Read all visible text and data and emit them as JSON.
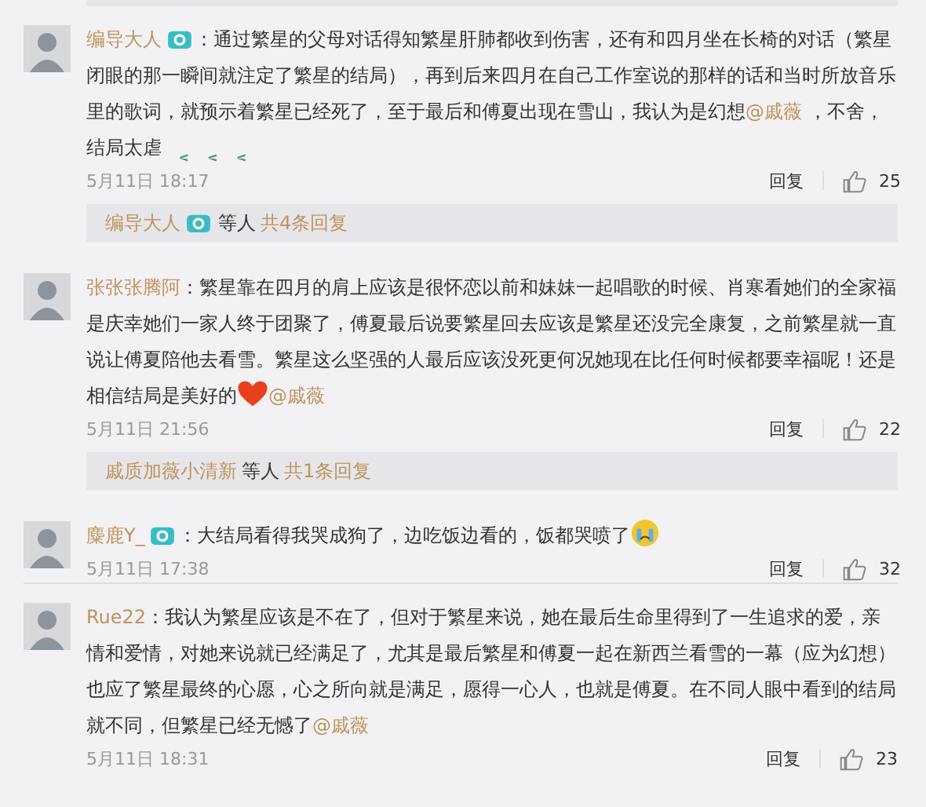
{
  "comments": [
    {
      "user": "编导大人",
      "badge": true,
      "parts": [
        {
          "kind": "text",
          "text": "：通过繁星的父母对话得知繁星肝肺都收到伤害，还有和四月坐在长椅的对话（繁星闭眼的那一瞬间就注定了繁星的结局），再到后来四月在自己工作室说的那样的话和当时所放音乐里的歌词，就预示着繁星已经死了，至于最后和傅夏出现在雪山，我认为是幻想"
        },
        {
          "kind": "mention",
          "text": "@戚薇"
        },
        {
          "kind": "text",
          "text": " ，不舍，结局太虐"
        },
        {
          "kind": "marks"
        }
      ],
      "time": "5月11日 18:17",
      "reply": "回复",
      "likes": "25",
      "thread": {
        "users": [
          {
            "name": "编导大人",
            "badge": true
          }
        ],
        "suffix": "等人",
        "count": "共4条回复"
      }
    },
    {
      "user": "张张张腾阿",
      "badge": false,
      "parts": [
        {
          "kind": "text",
          "text": "：繁星靠在四月的肩上应该是很怀恋以前和妹妹一起唱歌的时候、肖寒看她们的全家福是庆幸她们一家人终于团聚了，傅夏最后说要繁星回去应该是繁星还没完全康复，之前繁星就一直说让傅夏陪他去看雪。繁星这么坚强的人最后应该没死更何况她现在比任何时候都要幸福呢！还是相信结局是美好的"
        },
        {
          "kind": "heart"
        },
        {
          "kind": "mention",
          "text": "@戚薇"
        }
      ],
      "time": "5月11日 21:56",
      "reply": "回复",
      "likes": "22",
      "thread": {
        "users": [
          {
            "name": "戚质加薇小清新",
            "badge": false
          }
        ],
        "suffix": "等人",
        "count": "共1条回复"
      }
    },
    {
      "user": "麋鹿Y_",
      "badge": true,
      "parts": [
        {
          "kind": "text",
          "text": "：大结局看得我哭成狗了，边吃饭边看的，饭都哭喷了"
        },
        {
          "kind": "cry"
        }
      ],
      "time": "5月11日 17:38",
      "reply": "回复",
      "likes": "32"
    },
    {
      "user": "Rue22",
      "badge": false,
      "parts": [
        {
          "kind": "text",
          "text": "：我认为繁星应该是不在了，但对于繁星来说，她在最后生命里得到了一生追求的爱，亲情和爱情，对她来说就已经满足了，尤其是最后繁星和傅夏一起在新西兰看雪的一幕（应为幻想）也应了繁星最终的心愿，心之所向就是满足，愿得一心人，也就是傅夏。在不同人眼中看到的结局就不同，但繁星已经无憾了"
        },
        {
          "kind": "mention",
          "text": "@戚薇"
        }
      ],
      "time": "5月11日 18:31",
      "reply": "回复",
      "likes": "23"
    }
  ]
}
